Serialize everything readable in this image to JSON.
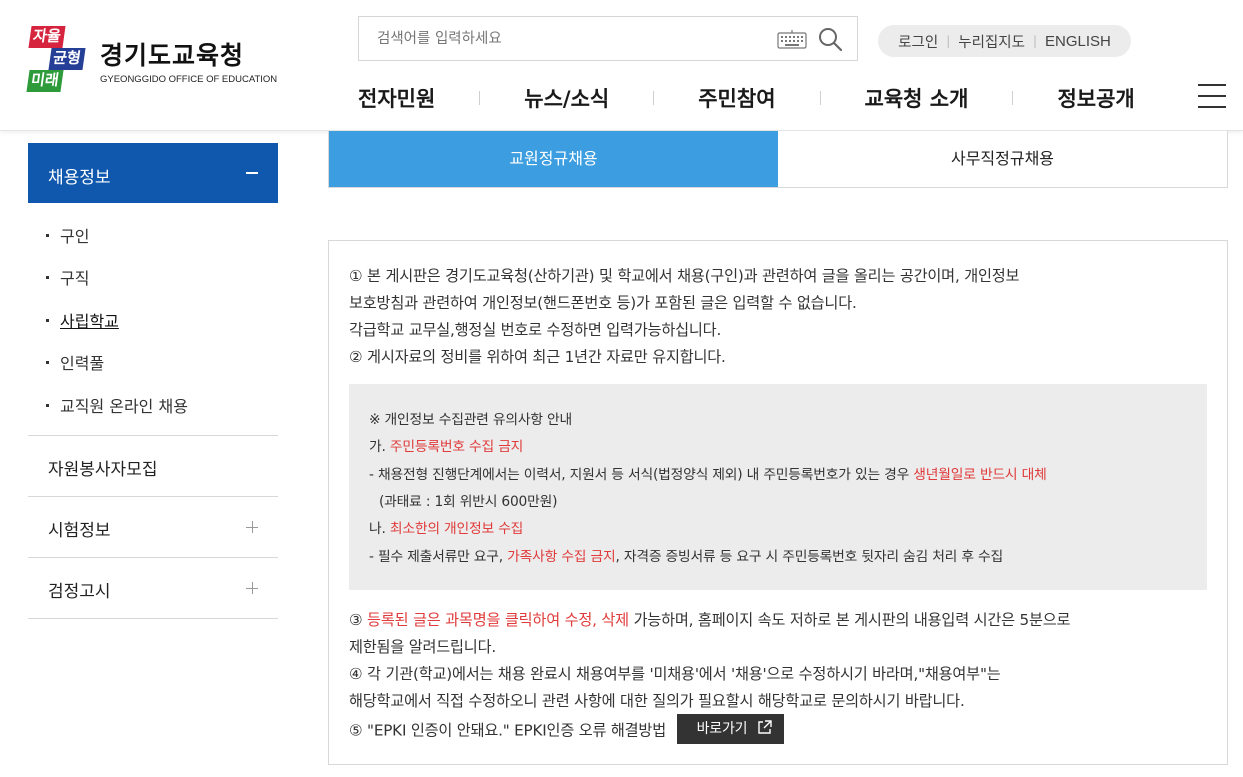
{
  "header": {
    "logo": {
      "badge": [
        "자율",
        "균형",
        "미래"
      ],
      "title": "경기도교육청",
      "subtitle": "GYEONGGIDO OFFICE OF EDUCATION"
    },
    "search": {
      "placeholder": "검색어를 입력하세요",
      "keyboard_icon": "keyboard-icon",
      "search_icon": "search-icon"
    },
    "util": {
      "login": "로그인",
      "sitemap": "누리집지도",
      "english": "ENGLISH"
    },
    "gnb": [
      "전자민원",
      "뉴스/소식",
      "주민참여",
      "교육청 소개",
      "정보공개"
    ],
    "menu_icon": "hamburger-icon"
  },
  "sidebar": {
    "active": "채용정보",
    "subitems": [
      "구인",
      "구직",
      "사립학교",
      "인력풀",
      "교직원 온라인 채용"
    ],
    "current_subitem": "사립학교",
    "others": [
      "자원봉사자모집",
      "시험정보",
      "검정고시"
    ]
  },
  "tabs": [
    {
      "label": "교원정규채용",
      "active": true
    },
    {
      "label": "사무직정규채용",
      "active": false
    }
  ],
  "notice": {
    "line1": "① 본 게시판은 경기도교육청(산하기관) 및 학교에서 채용(구인)과 관련하여 글을 올리는 공간이며, 개인정보",
    "line2": "보호방침과 관련하여 개인정보(핸드폰번호 등)가 포함된 글은 입력할 수 없습니다.",
    "line3": "각급학교 교무실,행정실 번호로 수정하면 입력가능하십니다.",
    "line4": "② 게시자료의 정비를 위하여 최근 1년간 자료만 유지합니다.",
    "box": {
      "title": "※ 개인정보 수집관련 유의사항 안내",
      "ga_prefix": "가. ",
      "ga_red": "주민등록번호 수집 금지",
      "ga_detail_a": "- 채용전형 진행단계에서는 이력서, 지원서 등 서식(법정양식 제외) 내 주민등록번호가 있는 경우 ",
      "ga_detail_red": "생년월일로 반드시 대체",
      "ga_fine": "(과태료 : 1회 위반시 600만원)",
      "na_prefix": "나. ",
      "na_red": "최소한의 개인정보 수집",
      "na_detail_a": "- 필수 제출서류만 요구, ",
      "na_detail_red": "가족사항 수집 금지",
      "na_detail_b": ", 자격증 증빙서류 등 요구 시 주민등록번호 뒷자리 숨김 처리 후 수집"
    },
    "line5_prefix": "③ ",
    "line5_red": "등록된 글은 과목명을 클릭하여 수정, 삭제",
    "line5_rest": " 가능하며, 홈페이지 속도 저하로 본 게시판의 내용입력 시간은 5분으로",
    "line6": "제한됨을 알려드립니다.",
    "line7": "④ 각 기관(학교)에서는 채용 완료시 채용여부를 '미채용'에서 '채용'으로 수정하시기 바라며,\"채용여부\"는",
    "line8": "해당학교에서 직접 수정하오니 관련 사항에 대한 질의가 필요할시 해당학교로 문의하시기 바랍니다.",
    "line9": "⑤ \"EPKI 인증이 안돼요.\" EPKI인증 오류 해결방법",
    "go_button": "바로가기"
  }
}
